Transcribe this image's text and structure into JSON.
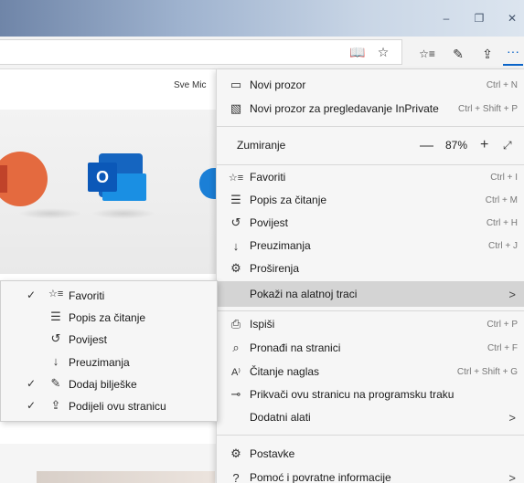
{
  "window": {
    "minimize": "–",
    "restore": "❐",
    "close": "✕"
  },
  "toolbar": {
    "reading_view_icon": "📖",
    "favorite_star": "☆",
    "favorites_hub": "☆≡",
    "notes_pen": "✎",
    "share": "⇪",
    "more": "···"
  },
  "page": {
    "nav_text": "Sve Mic"
  },
  "menu": {
    "new_window": {
      "icon": "▭",
      "label": "Novi prozor",
      "shortcut": "Ctrl + N"
    },
    "inprivate": {
      "icon": "▧",
      "label": "Novi prozor za pregledavanje InPrivate",
      "shortcut": "Ctrl + Shift + P"
    },
    "zoom": {
      "label": "Zumiranje",
      "minus": "—",
      "value": "87%",
      "plus": "+",
      "fullscreen": "⤢"
    },
    "favorites": {
      "icon": "☆≡",
      "label": "Favoriti",
      "shortcut": "Ctrl + I"
    },
    "reading_list": {
      "icon": "☰",
      "label": "Popis za čitanje",
      "shortcut": "Ctrl + M"
    },
    "history": {
      "icon": "↺",
      "label": "Povijest",
      "shortcut": "Ctrl + H"
    },
    "downloads": {
      "icon": "↓",
      "label": "Preuzimanja",
      "shortcut": "Ctrl + J"
    },
    "extensions": {
      "icon": "⚙",
      "label": "Proširenja"
    },
    "show_on_toolbar": {
      "label": "Pokaži na alatnoj traci",
      "chevron": ">"
    },
    "print": {
      "icon": "⎙",
      "label": "Ispiši",
      "shortcut": "Ctrl + P"
    },
    "find": {
      "icon": "⌕",
      "label": "Pronađi na stranici",
      "shortcut": "Ctrl + F"
    },
    "read_aloud": {
      "icon": "A⁾",
      "label": "Čitanje naglas",
      "shortcut": "Ctrl + Shift + G"
    },
    "pin_taskbar": {
      "icon": "⊸",
      "label": "Prikvači ovu stranicu na programsku traku"
    },
    "more_tools": {
      "label": "Dodatni alati",
      "chevron": ">"
    },
    "settings": {
      "icon": "⚙",
      "label": "Postavke"
    },
    "help": {
      "icon": "?",
      "label": "Pomoć i povratne informacije",
      "chevron": ">"
    }
  },
  "submenu": {
    "items": [
      {
        "checked": "✓",
        "icon": "☆≡",
        "label": "Favoriti"
      },
      {
        "checked": "",
        "icon": "☰",
        "label": "Popis za čitanje"
      },
      {
        "checked": "",
        "icon": "↺",
        "label": "Povijest"
      },
      {
        "checked": "",
        "icon": "↓",
        "label": "Preuzimanja"
      },
      {
        "checked": "✓",
        "icon": "✎",
        "label": "Dodaj bilješke"
      },
      {
        "checked": "✓",
        "icon": "⇪",
        "label": "Podijeli ovu stranicu"
      }
    ]
  },
  "colors": {
    "accent": "#0a64c8",
    "highlight": "#d4d4d4",
    "menu_bg": "#f6f6f6"
  }
}
